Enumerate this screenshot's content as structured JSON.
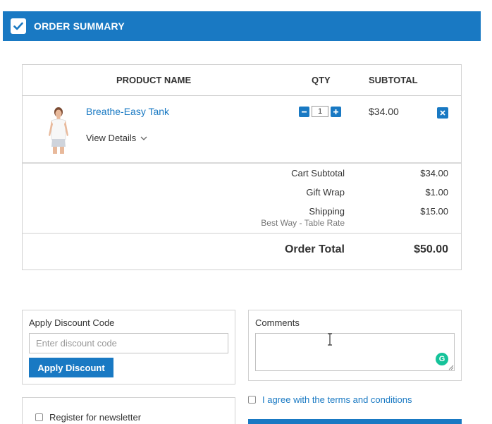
{
  "header": {
    "title": "ORDER SUMMARY",
    "icon": "checkbox-checked-icon",
    "color": "#1979c3"
  },
  "table": {
    "columns": {
      "product": "PRODUCT NAME",
      "qty": "QTY",
      "subtotal": "SUBTOTAL"
    },
    "item": {
      "name": "Breathe-Easy Tank",
      "view_details": "View Details",
      "qty": "1",
      "subtotal": "$34.00",
      "image": "tank-top-model-image"
    }
  },
  "totals": {
    "cart_subtotal_label": "Cart Subtotal",
    "cart_subtotal_value": "$34.00",
    "gift_wrap_label": "Gift Wrap",
    "gift_wrap_value": "$1.00",
    "shipping_label": "Shipping",
    "shipping_method": "Best Way - Table Rate",
    "shipping_value": "$15.00",
    "order_total_label": "Order Total",
    "order_total_value": "$50.00"
  },
  "discount": {
    "title": "Apply Discount Code",
    "placeholder": "Enter discount code",
    "button": "Apply Discount"
  },
  "comments": {
    "title": "Comments"
  },
  "terms": {
    "label": "I agree with the terms and conditions",
    "color": "#1979c3"
  },
  "newsletter": {
    "label": "Register for newsletter"
  }
}
